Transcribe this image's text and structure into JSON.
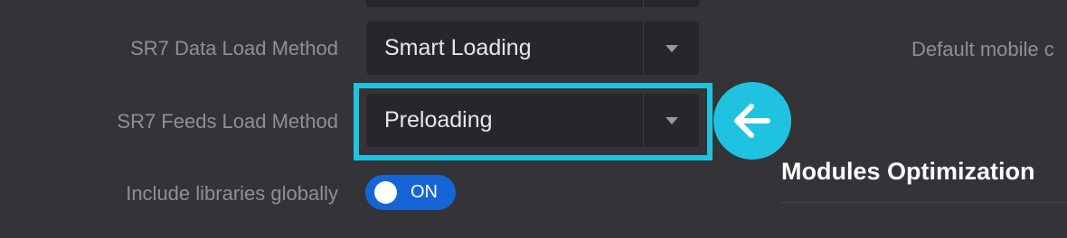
{
  "settings": {
    "data_load_method": {
      "label": "SR7 Data Load Method",
      "value": "Smart Loading"
    },
    "feeds_load_method": {
      "label": "SR7 Feeds Load Method",
      "value": "Preloading"
    },
    "include_libraries": {
      "label": "Include libraries globally",
      "state": "ON"
    }
  },
  "right_column": {
    "truncated_label": "Default mobile c",
    "section_title": "Modules Optimization"
  },
  "annotation": {
    "icon": "arrow-left-icon",
    "color": "#1fc3e0"
  },
  "colors": {
    "background": "#333338",
    "select_bg": "#27272b",
    "toggle_on": "#1565d6",
    "highlight": "#1fc3e0"
  }
}
